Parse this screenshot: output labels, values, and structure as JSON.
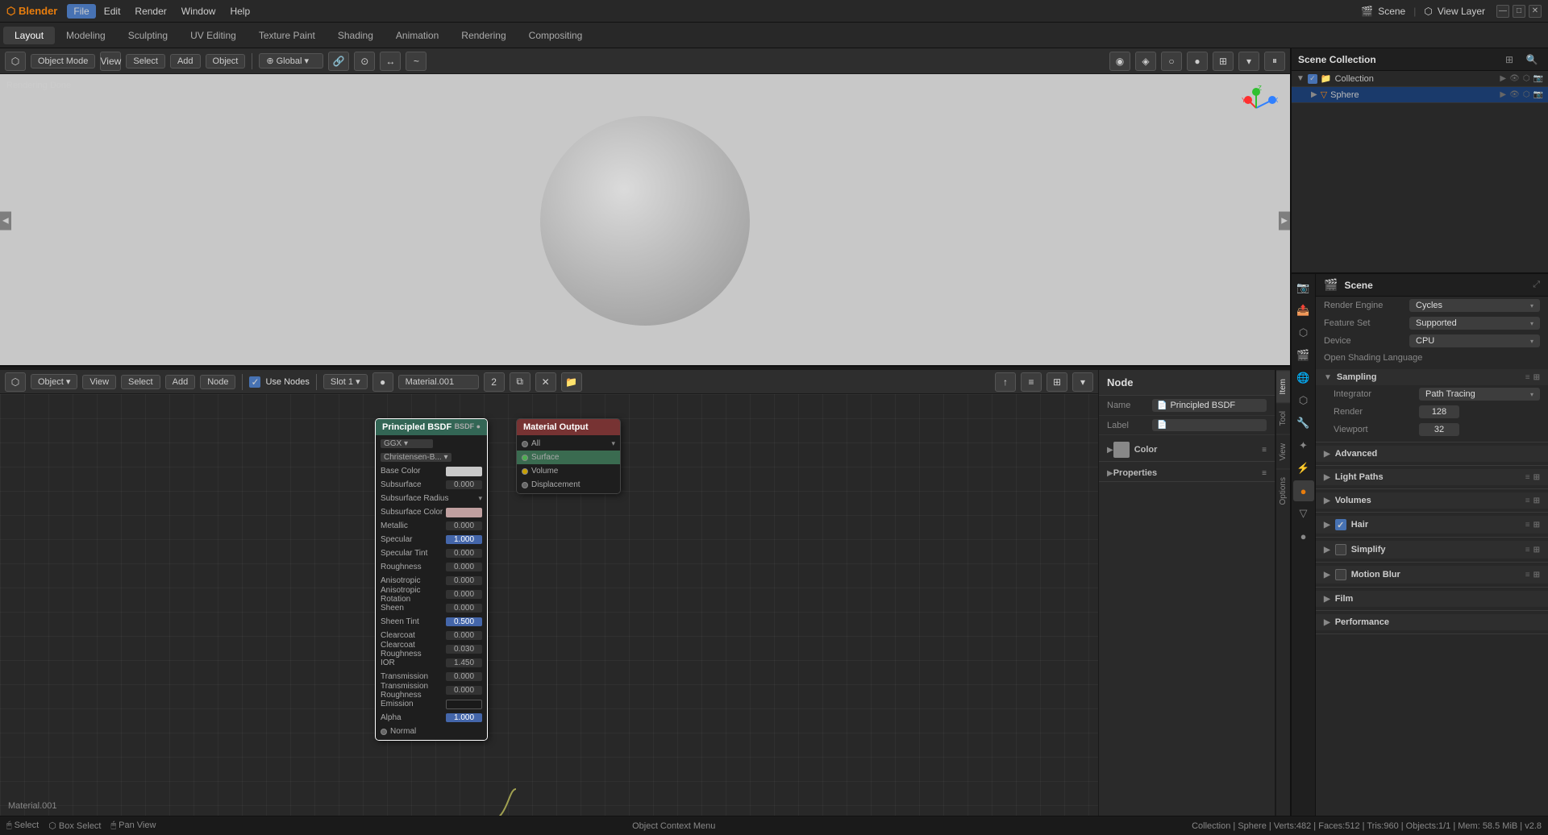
{
  "app": {
    "title": "Blender",
    "version": "v2.8"
  },
  "titleBar": {
    "menus": [
      "File",
      "Edit",
      "Render",
      "Window",
      "Help"
    ],
    "activeMenu": "File",
    "sceneLabel": "Scene",
    "viewLayerLabel": "View Layer"
  },
  "tabs": [
    "Layout",
    "Modeling",
    "Sculpting",
    "UV Editing",
    "Texture Paint",
    "Shading",
    "Animation",
    "Rendering",
    "Compositing"
  ],
  "activeTab": "Layout",
  "viewport": {
    "mode": "Object Mode",
    "buttons": [
      "View",
      "Select",
      "Add",
      "Object"
    ],
    "pivot": "Global",
    "status": "Rendering Done",
    "material": "Material.001"
  },
  "nodeEditor": {
    "mode": "Object",
    "buttons": [
      "View",
      "Select",
      "Add",
      "Node"
    ],
    "useNodes": true,
    "slot": "Slot 1",
    "material": "Material.001",
    "materialLabel": "Material.001",
    "nodes": {
      "bsdf": {
        "title": "Principled BSDF",
        "label": "BSDF",
        "fields": [
          {
            "name": "GGX",
            "type": "select"
          },
          {
            "name": "Christensen-Burley",
            "type": "select"
          },
          {
            "name": "Base Color",
            "type": "color",
            "value": "#c8c8c8"
          },
          {
            "name": "Subsurface",
            "type": "number",
            "value": "0.000"
          },
          {
            "name": "Subsurface Radius",
            "type": "select"
          },
          {
            "name": "Subsurface Color",
            "type": "color2",
            "value": "#c8c8c8"
          },
          {
            "name": "Metallic",
            "type": "number",
            "value": "0.000"
          },
          {
            "name": "Specular",
            "type": "number-highlight",
            "value": "1.000"
          },
          {
            "name": "Specular Tint",
            "type": "number",
            "value": "0.000"
          },
          {
            "name": "Roughness",
            "type": "number",
            "value": "0.000"
          },
          {
            "name": "Anisotropic",
            "type": "number",
            "value": "0.000"
          },
          {
            "name": "Anisotropic Rotation",
            "type": "number",
            "value": "0.000"
          },
          {
            "name": "Sheen",
            "type": "number",
            "value": "0.000"
          },
          {
            "name": "Sheen Tint",
            "type": "number-blue",
            "value": "0.500"
          },
          {
            "name": "Clearcoat",
            "type": "number",
            "value": "0.000"
          },
          {
            "name": "Clearcoat Roughness",
            "type": "number",
            "value": "0.030"
          },
          {
            "name": "IOR",
            "type": "number",
            "value": "1.450"
          },
          {
            "name": "Transmission",
            "type": "number",
            "value": "0.000"
          },
          {
            "name": "Transmission Roughness",
            "type": "number",
            "value": "0.000"
          },
          {
            "name": "Emission",
            "type": "color-dark",
            "value": "#1a1a1a"
          },
          {
            "name": "Alpha",
            "type": "number-blue2",
            "value": "1.000"
          },
          {
            "name": "Normal",
            "type": "text"
          }
        ]
      },
      "output": {
        "title": "Material Output",
        "sockets": [
          "All",
          "Surface",
          "Volume",
          "Displacement"
        ]
      }
    }
  },
  "nodeProperties": {
    "title": "Node",
    "nameLabel": "Name",
    "nameValue": "Principled BSDF",
    "labelLabel": "Label",
    "sections": [
      "Color",
      "Properties"
    ]
  },
  "outliner": {
    "title": "Scene Collection",
    "items": [
      {
        "name": "Collection",
        "type": "collection",
        "indent": 0
      },
      {
        "name": "Sphere",
        "type": "mesh",
        "indent": 1,
        "selected": true
      }
    ]
  },
  "propertiesPanel": {
    "title": "Scene",
    "icon": "scene",
    "sections": {
      "renderEngine": {
        "label": "Render Engine",
        "value": "Cycles"
      },
      "featureSet": {
        "label": "Feature Set",
        "value": "Supported"
      },
      "device": {
        "label": "Device",
        "value": "CPU"
      },
      "openShadingLanguage": {
        "label": "Open Shading Language"
      },
      "sampling": {
        "title": "Sampling",
        "integrator": {
          "label": "Integrator",
          "value": "Path Tracing"
        },
        "render": {
          "label": "Render",
          "value": "128"
        },
        "viewport": {
          "label": "Viewport",
          "value": "32"
        }
      },
      "advanced": {
        "title": "Advanced"
      },
      "lightPaths": {
        "title": "Light Paths"
      },
      "volumes": {
        "title": "Volumes"
      },
      "hair": {
        "title": "Hair",
        "checked": true
      },
      "simplify": {
        "title": "Simplify",
        "checked": false
      },
      "motionBlur": {
        "title": "Motion Blur",
        "checked": false
      },
      "film": {
        "title": "Film"
      },
      "performance": {
        "title": "Performance"
      }
    }
  },
  "statusBar": {
    "left": [
      "Select",
      "Box Select",
      "Pan View"
    ],
    "center": "Object Context Menu",
    "right": "Collection | Sphere | Verts:482 | Faces:512 | Tris:960 | Objects:1/1 | Mem: 58.5 MiB | v2.8"
  },
  "icons": {
    "blender": "🔶",
    "scene": "🎬",
    "render": "📷",
    "output": "📤",
    "view": "👁",
    "object": "⬡",
    "modifier": "🔧",
    "particle": "✦",
    "physics": "⚡",
    "constraint": "🔗",
    "data": "▽",
    "material": "●",
    "world": "🌐",
    "search": "🔍",
    "filter": "⊞"
  }
}
